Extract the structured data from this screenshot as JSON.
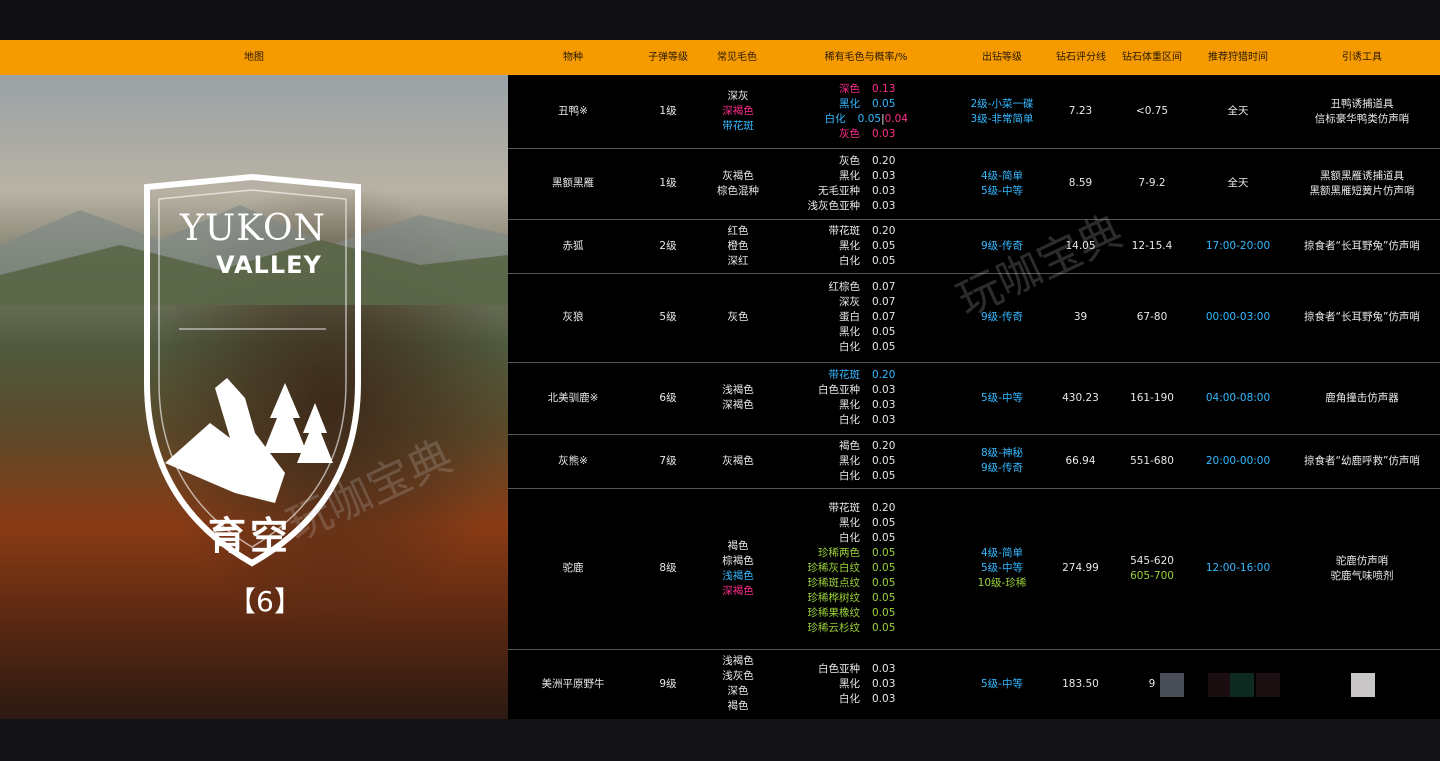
{
  "header": [
    "地图",
    "物种",
    "子弹等级",
    "常见毛色",
    "稀有毛色与概率/%",
    "出钻等级",
    "钻石评分线",
    "钻石体重区间",
    "推荐狩猎时间",
    "引诱工具"
  ],
  "map": {
    "logo_line1": "YUKON",
    "logo_line2": "VALLEY",
    "region": "育空",
    "species_count": "【6】"
  },
  "watermark": "玩咖宝典",
  "colors": {
    "header": "#f59b00",
    "pink": "#ff2d8a",
    "blue": "#35b8ff",
    "green": "#9cd23a"
  },
  "rows": [
    {
      "species": "丑鸭※",
      "ammo": "1级",
      "common": [
        {
          "t": "深灰",
          "c": ""
        },
        {
          "t": "深褐色",
          "c": "pink"
        },
        {
          "t": "带花斑",
          "c": "blue"
        }
      ],
      "rare": [
        {
          "n": "深色",
          "v": "0.13",
          "c": "pink"
        },
        {
          "n": "黑化",
          "v": "0.05",
          "c": "blue"
        },
        {
          "n": "白化",
          "v": "0.05",
          "v2": "0.04",
          "c": "blue"
        },
        {
          "n": "灰色",
          "v": "0.03",
          "c": "pink"
        }
      ],
      "levels": [
        {
          "t": "2级-小菜一碟",
          "c": "blue"
        },
        {
          "t": "3级-非常简单",
          "c": "blue"
        }
      ],
      "score": "7.23",
      "weight": [
        {
          "t": "<0.75",
          "c": ""
        }
      ],
      "time": {
        "t": "全天",
        "c": ""
      },
      "lure": [
        "丑鸭诱捕道具",
        "信标豪华鸭类仿声哨"
      ]
    },
    {
      "species": "黑额黑雁",
      "ammo": "1级",
      "common": [
        {
          "t": "灰褐色",
          "c": ""
        },
        {
          "t": "棕色混种",
          "c": ""
        }
      ],
      "rare": [
        {
          "n": "灰色",
          "v": "0.20",
          "c": ""
        },
        {
          "n": "黑化",
          "v": "0.03",
          "c": ""
        },
        {
          "n": "无毛亚种",
          "v": "0.03",
          "c": ""
        },
        {
          "n": "浅灰色亚种",
          "v": "0.03",
          "c": ""
        }
      ],
      "levels": [
        {
          "t": "4级-简单",
          "c": "blue"
        },
        {
          "t": "5级-中等",
          "c": "blue"
        }
      ],
      "score": "8.59",
      "weight": [
        {
          "t": "7-9.2",
          "c": ""
        }
      ],
      "time": {
        "t": "全天",
        "c": ""
      },
      "lure": [
        "黑额黑雁诱捕道具",
        "黑额黑雁短簧片仿声哨"
      ]
    },
    {
      "species": "赤狐",
      "ammo": "2级",
      "common": [
        {
          "t": "红色",
          "c": ""
        },
        {
          "t": "橙色",
          "c": ""
        },
        {
          "t": "深红",
          "c": ""
        }
      ],
      "rare": [
        {
          "n": "带花斑",
          "v": "0.20",
          "c": ""
        },
        {
          "n": "黑化",
          "v": "0.05",
          "c": ""
        },
        {
          "n": "白化",
          "v": "0.05",
          "c": ""
        }
      ],
      "levels": [
        {
          "t": "9级-传奇",
          "c": "blue"
        }
      ],
      "score": "14.05",
      "weight": [
        {
          "t": "12-15.4",
          "c": ""
        }
      ],
      "time": {
        "t": "17:00-20:00",
        "c": "blue"
      },
      "lure": [
        "掠食者“长耳野兔”仿声哨"
      ]
    },
    {
      "species": "灰狼",
      "ammo": "5级",
      "common": [
        {
          "t": "灰色",
          "c": ""
        }
      ],
      "rare": [
        {
          "n": "红棕色",
          "v": "0.07",
          "c": ""
        },
        {
          "n": "深灰",
          "v": "0.07",
          "c": ""
        },
        {
          "n": "蛋白",
          "v": "0.07",
          "c": ""
        },
        {
          "n": "黑化",
          "v": "0.05",
          "c": ""
        },
        {
          "n": "白化",
          "v": "0.05",
          "c": ""
        }
      ],
      "levels": [
        {
          "t": "9级-传奇",
          "c": "blue"
        }
      ],
      "score": "39",
      "weight": [
        {
          "t": "67-80",
          "c": ""
        }
      ],
      "time": {
        "t": "00:00-03:00",
        "c": "blue"
      },
      "lure": [
        "掠食者“长耳野兔”仿声哨"
      ]
    },
    {
      "species": "北美驯鹿※",
      "ammo": "6级",
      "common": [
        {
          "t": "浅褐色",
          "c": ""
        },
        {
          "t": "深褐色",
          "c": ""
        }
      ],
      "rare": [
        {
          "n": "带花斑",
          "v": "0.20",
          "c": "blue"
        },
        {
          "n": "白色亚种",
          "v": "0.03",
          "c": ""
        },
        {
          "n": "黑化",
          "v": "0.03",
          "c": ""
        },
        {
          "n": "白化",
          "v": "0.03",
          "c": ""
        }
      ],
      "levels": [
        {
          "t": "5级-中等",
          "c": "blue"
        }
      ],
      "score": "430.23",
      "weight": [
        {
          "t": "161-190",
          "c": ""
        }
      ],
      "time": {
        "t": "04:00-08:00",
        "c": "blue"
      },
      "lure": [
        "鹿角撞击仿声器"
      ]
    },
    {
      "species": "灰熊※",
      "ammo": "7级",
      "common": [
        {
          "t": "灰褐色",
          "c": ""
        }
      ],
      "rare": [
        {
          "n": "褐色",
          "v": "0.20",
          "c": ""
        },
        {
          "n": "黑化",
          "v": "0.05",
          "c": ""
        },
        {
          "n": "白化",
          "v": "0.05",
          "c": ""
        }
      ],
      "levels": [
        {
          "t": "8级-神秘",
          "c": "blue"
        },
        {
          "t": "9级-传奇",
          "c": "blue"
        }
      ],
      "score": "66.94",
      "weight": [
        {
          "t": "551-680",
          "c": ""
        }
      ],
      "time": {
        "t": "20:00-00:00",
        "c": "blue"
      },
      "lure": [
        "掠食者“幼鹿呼救”仿声哨"
      ]
    },
    {
      "species": "驼鹿",
      "ammo": "8级",
      "common": [
        {
          "t": "褐色",
          "c": ""
        },
        {
          "t": "棕褐色",
          "c": ""
        },
        {
          "t": "浅褐色",
          "c": "blue"
        },
        {
          "t": "深褐色",
          "c": "pink"
        }
      ],
      "rare": [
        {
          "n": "带花斑",
          "v": "0.20",
          "c": ""
        },
        {
          "n": "黑化",
          "v": "0.05",
          "c": ""
        },
        {
          "n": "白化",
          "v": "0.05",
          "c": ""
        },
        {
          "n": "珍稀两色",
          "v": "0.05",
          "c": "green"
        },
        {
          "n": "珍稀灰白纹",
          "v": "0.05",
          "c": "green"
        },
        {
          "n": "珍稀斑点纹",
          "v": "0.05",
          "c": "green"
        },
        {
          "n": "珍稀桦树纹",
          "v": "0.05",
          "c": "green"
        },
        {
          "n": "珍稀果橡纹",
          "v": "0.05",
          "c": "green"
        },
        {
          "n": "珍稀云杉纹",
          "v": "0.05",
          "c": "green"
        }
      ],
      "levels": [
        {
          "t": "4级-简单",
          "c": "blue"
        },
        {
          "t": "5级-中等",
          "c": "blue"
        },
        {
          "t": "10级-珍稀",
          "c": "green"
        }
      ],
      "score": "274.99",
      "weight": [
        {
          "t": "545-620",
          "c": ""
        },
        {
          "t": "605-700",
          "c": "green"
        }
      ],
      "time": {
        "t": "12:00-16:00",
        "c": "blue"
      },
      "lure": [
        "驼鹿仿声哨",
        "驼鹿气味喷剂"
      ]
    },
    {
      "species": "美洲平原野牛",
      "ammo": "9级",
      "common": [
        {
          "t": "浅褐色",
          "c": ""
        },
        {
          "t": "浅灰色",
          "c": ""
        },
        {
          "t": "深色",
          "c": ""
        },
        {
          "t": "褐色",
          "c": ""
        }
      ],
      "rare": [
        {
          "n": "白色亚种",
          "v": "0.03",
          "c": ""
        },
        {
          "n": "黑化",
          "v": "0.03",
          "c": ""
        },
        {
          "n": "白化",
          "v": "0.03",
          "c": ""
        }
      ],
      "levels": [
        {
          "t": "5级-中等",
          "c": "blue"
        }
      ],
      "score": "183.50",
      "weight": [
        {
          "t": "9",
          "c": ""
        }
      ],
      "time": {
        "t": "",
        "c": ""
      },
      "lure": []
    }
  ]
}
